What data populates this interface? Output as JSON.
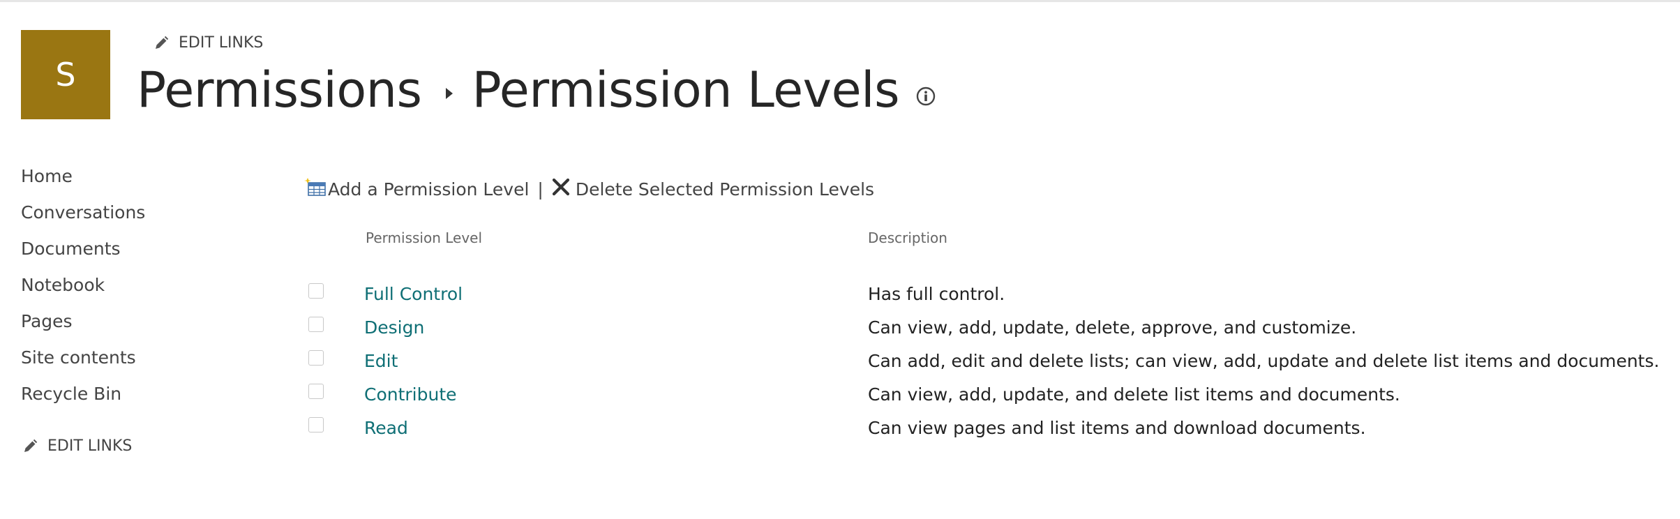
{
  "site": {
    "logo_letter": "S",
    "logo_color": "#9a7612"
  },
  "header": {
    "edit_links_label": "EDIT LINKS",
    "edit_icon": "pencil-icon",
    "breadcrumb_parent": "Permissions",
    "title": "Permission Levels",
    "info_icon": "info-icon"
  },
  "left_nav": {
    "items": [
      {
        "label": "Home"
      },
      {
        "label": "Conversations"
      },
      {
        "label": "Documents"
      },
      {
        "label": "Notebook"
      },
      {
        "label": "Pages"
      },
      {
        "label": "Site contents"
      },
      {
        "label": "Recycle Bin"
      }
    ],
    "edit_links_label": "EDIT LINKS"
  },
  "toolbar": {
    "add_label": "Add a Permission Level",
    "add_icon": "add-table-icon",
    "separator": "|",
    "delete_label": "Delete Selected Permission Levels",
    "delete_icon": "delete-x-icon"
  },
  "table": {
    "headers": {
      "level": "Permission Level",
      "description": "Description"
    },
    "rows": [
      {
        "level": "Full Control",
        "description": "Has full control.",
        "checked": false
      },
      {
        "level": "Design",
        "description": "Can view, add, update, delete, approve, and customize.",
        "checked": false
      },
      {
        "level": "Edit",
        "description": "Can add, edit and delete lists; can view, add, update and delete list items and documents.",
        "checked": false
      },
      {
        "level": "Contribute",
        "description": "Can view, add, update, and delete list items and documents.",
        "checked": false
      },
      {
        "level": "Read",
        "description": "Can view pages and list items and download documents.",
        "checked": false
      }
    ]
  },
  "colors": {
    "link": "#0f6f75",
    "text": "#333333",
    "header_text": "#666666"
  }
}
